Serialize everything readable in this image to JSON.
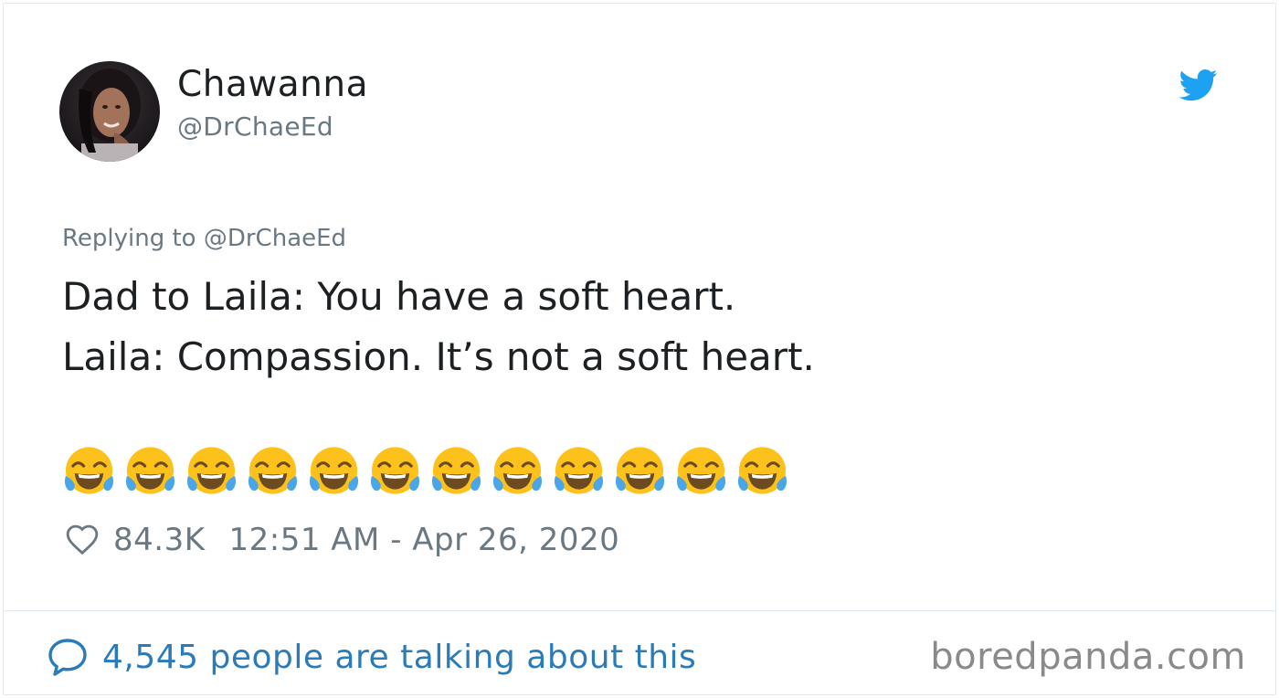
{
  "tweet": {
    "author": {
      "display_name": "Chawanna",
      "handle": "@DrChaeEd",
      "avatar": "profile-photo"
    },
    "replying_to": "Replying to @DrChaeEd",
    "text_lines": [
      "Dad to Laila: You have a soft heart.",
      "Laila: Compassion. It’s not a soft heart."
    ],
    "emoji": {
      "name": "face-with-tears-of-joy",
      "count": 12
    },
    "likes": "84.3K",
    "timestamp": "12:51 AM - Apr 26, 2020",
    "platform_icon": "twitter-bird-icon"
  },
  "footer": {
    "talking": "4,545 people are talking about this",
    "watermark": "boredpanda.com"
  },
  "colors": {
    "twitter_blue": "#1da1f2",
    "link_blue": "#2b7bb9",
    "text_dark": "#1c2022",
    "text_gray": "#697882",
    "border": "#e1e8ed"
  }
}
